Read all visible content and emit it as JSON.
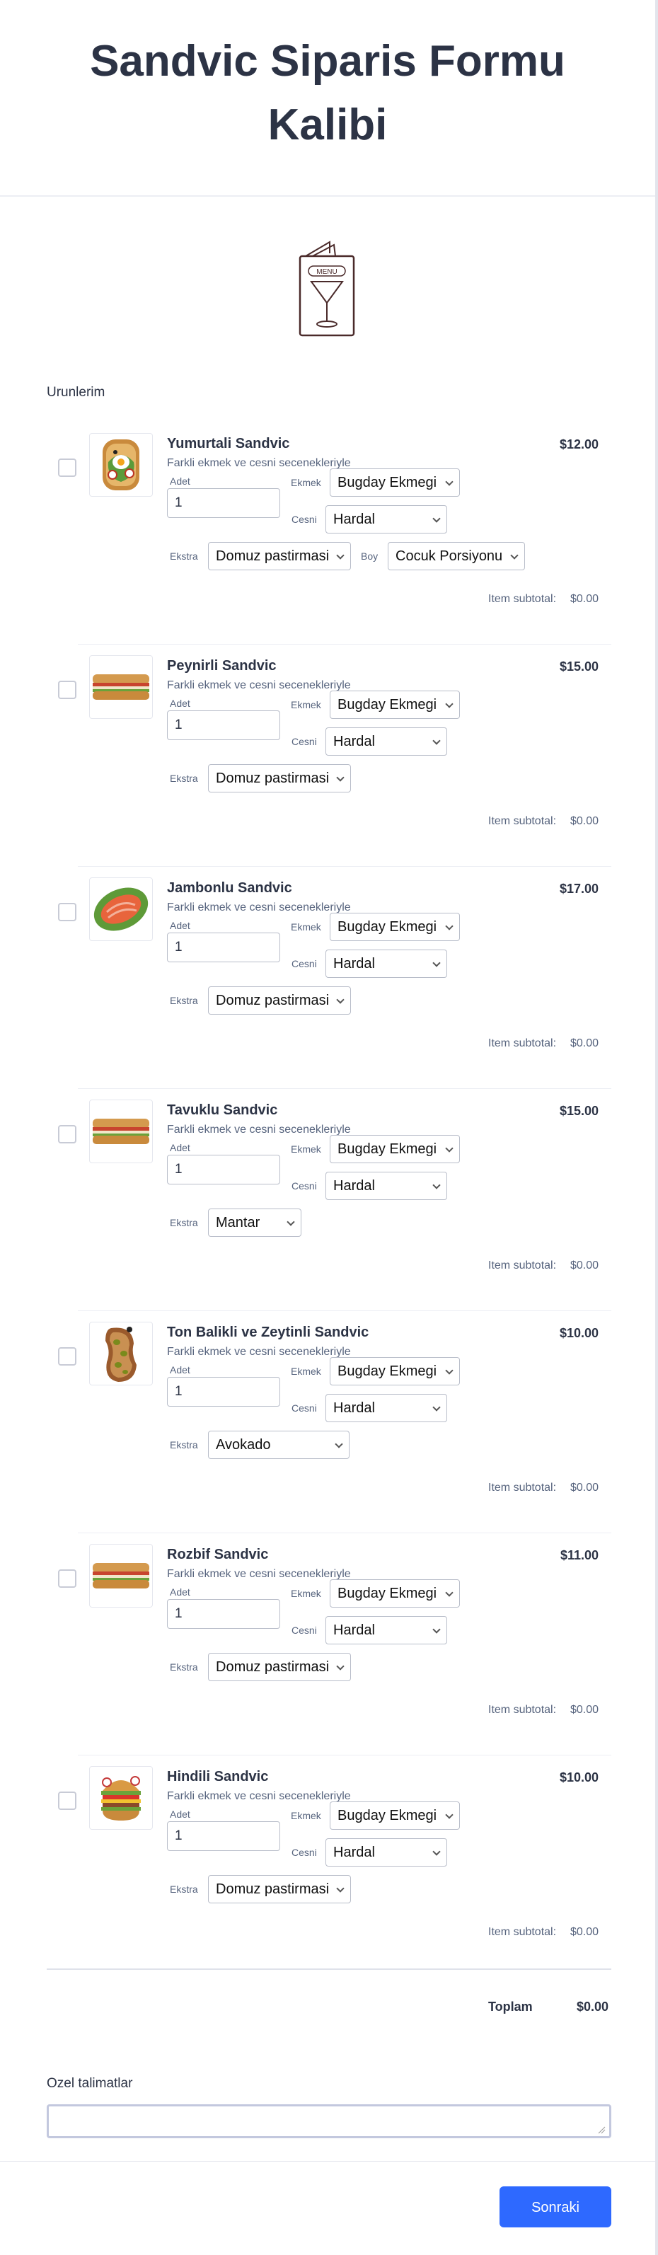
{
  "form": {
    "title": "Sandvic Siparis Formu Kalibi",
    "logo_text": "MENU",
    "section_label": "Urunlerim",
    "labels": {
      "qty": "Adet",
      "bread": "Ekmek",
      "sauce": "Cesni",
      "extra": "Ekstra",
      "size": "Boy",
      "item_subtotal": "Item subtotal:"
    },
    "products": [
      {
        "name": "Yumurtali Sandvic",
        "desc": "Farkli ekmek ve cesni secenekleriyle",
        "price": "$12.00",
        "qty": "1",
        "bread": "Bugday Ekmegi",
        "sauce": "Hardal",
        "extra": "Domuz pastirmasi",
        "size": "Cocuk Porsiyonu",
        "subtotal": "$0.00",
        "image": "egg-toast"
      },
      {
        "name": "Peynirli Sandvic",
        "desc": "Farkli ekmek ve cesni secenekleriyle",
        "price": "$15.00",
        "qty": "1",
        "bread": "Bugday Ekmegi",
        "sauce": "Hardal",
        "extra": "Domuz pastirmasi",
        "subtotal": "$0.00",
        "image": "baguette"
      },
      {
        "name": "Jambonlu Sandvic",
        "desc": "Farkli ekmek ve cesni secenekleriyle",
        "price": "$17.00",
        "qty": "1",
        "bread": "Bugday Ekmegi",
        "sauce": "Hardal",
        "extra": "Domuz pastirmasi",
        "subtotal": "$0.00",
        "image": "salmon-toast"
      },
      {
        "name": "Tavuklu Sandvic",
        "desc": "Farkli ekmek ve cesni secenekleriyle",
        "price": "$15.00",
        "qty": "1",
        "bread": "Bugday Ekmegi",
        "sauce": "Hardal",
        "extra": "Mantar",
        "subtotal": "$0.00",
        "image": "baguette"
      },
      {
        "name": "Ton Balikli ve Zeytinli Sandvic",
        "desc": "Farkli ekmek ve cesni secenekleriyle",
        "price": "$10.00",
        "qty": "1",
        "bread": "Bugday Ekmegi",
        "sauce": "Hardal",
        "extra": "Avokado",
        "subtotal": "$0.00",
        "image": "olive-toast"
      },
      {
        "name": "Rozbif Sandvic",
        "desc": "Farkli ekmek ve cesni secenekleriyle",
        "price": "$11.00",
        "qty": "1",
        "bread": "Bugday Ekmegi",
        "sauce": "Hardal",
        "extra": "Domuz pastirmasi",
        "subtotal": "$0.00",
        "image": "baguette"
      },
      {
        "name": "Hindili Sandvic",
        "desc": "Farkli ekmek ve cesni secenekleriyle",
        "price": "$10.00",
        "qty": "1",
        "bread": "Bugday Ekmegi",
        "sauce": "Hardal",
        "extra": "Domuz pastirmasi",
        "subtotal": "$0.00",
        "image": "burger"
      }
    ],
    "total_label": "Toplam",
    "total_value": "$0.00",
    "notes_label": "Ozel talimatlar",
    "notes_value": "",
    "next_button": "Sonraki"
  },
  "colors": {
    "accent": "#2e69ff",
    "text": "#2c3345",
    "muted": "#57647e",
    "border": "#b8bdc9"
  }
}
